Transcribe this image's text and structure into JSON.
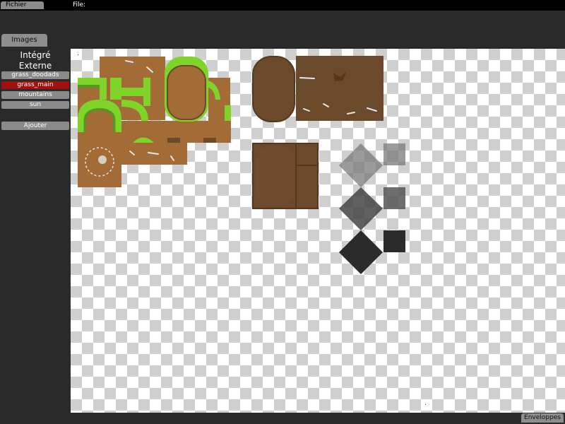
{
  "menubar": {
    "fichier_label": "Fichier",
    "file_label": "File:"
  },
  "left_panel": {
    "tab_label": "Images",
    "sections": {
      "integre": "Intégré",
      "externe": "Externe"
    },
    "images": [
      {
        "label": "grass_doodads",
        "selected": false
      },
      {
        "label": "grass_main",
        "selected": true
      },
      {
        "label": "mountains",
        "selected": false
      },
      {
        "label": "sun",
        "selected": false
      }
    ],
    "add_label": "Ajouter"
  },
  "bottom": {
    "envelopes_label": "Enveloppes"
  },
  "colors": {
    "background": "#2a2a2a",
    "menubar": "#000000",
    "button": "#8c8c8c",
    "selected": "#a01010",
    "dirt": "#a36b36",
    "dirt_dark": "#6b4a2c",
    "grass": "#7fd42a",
    "grass_dark": "#4c9a20"
  }
}
